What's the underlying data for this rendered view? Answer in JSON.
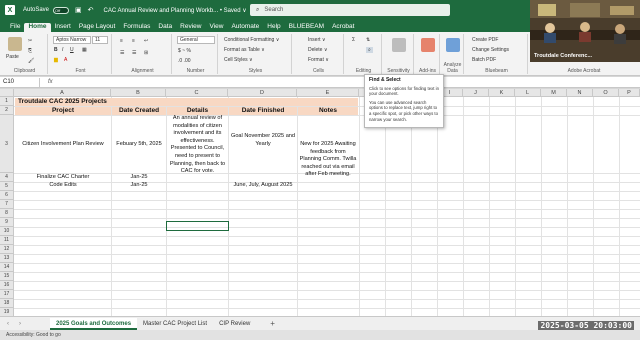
{
  "app": {
    "autosave_label": "AutoSave",
    "autosave_state": "Off",
    "doc_title": "CAC Annual Review and Planning Workb... • Saved ∨",
    "search_placeholder": "Search"
  },
  "menu": [
    "File",
    "Home",
    "Insert",
    "Page Layout",
    "Formulas",
    "Data",
    "Review",
    "View",
    "Automate",
    "Help",
    "BLUEBEAM",
    "Acrobat"
  ],
  "ribbon": {
    "paste": "Paste",
    "clipboard": "Clipboard",
    "font_name": "Aptos Narrow",
    "font_size": "11",
    "font": "Font",
    "alignment": "Alignment",
    "number_format": "General",
    "number": "Number",
    "conditional": "Conditional Formatting ∨",
    "format_table": "Format as Table ∨",
    "cell_styles": "Cell Styles ∨",
    "styles": "Styles",
    "insert": "Insert ∨",
    "delete": "Delete ∨",
    "format": "Format ∨",
    "cells": "Cells",
    "editing": "Editing",
    "sensitivity": "Sensitivity",
    "addins": "Add-ins",
    "analyze": "Analyze Data",
    "create_pdf": "Create PDF",
    "change_settings": "Change Settings",
    "batch_pdf": "Batch PDF",
    "bluebeam": "Bluebeam",
    "adobe": "Adobe Acrobat"
  },
  "formula_bar": {
    "cell_ref": "C10",
    "fx": "fx"
  },
  "tooltip": {
    "title": "Find & Select",
    "line1": "Click to see options for finding text in your document.",
    "line2": "You can use advanced search options to replace text, jump right to a specific spot, or pick other ways to narrow your search."
  },
  "columns": [
    "A",
    "B",
    "C",
    "D",
    "E",
    "F",
    "G",
    "H",
    "I",
    "J",
    "K",
    "L",
    "M",
    "N",
    "O",
    "P"
  ],
  "rows": [
    "1",
    "2",
    "3",
    "4",
    "5",
    "6",
    "7",
    "8",
    "9",
    "10",
    "11",
    "12",
    "13",
    "14",
    "15",
    "16",
    "17",
    "18",
    "19",
    "20",
    "21",
    "22",
    "23",
    "24",
    "25",
    "26"
  ],
  "sheet": {
    "title": "Troutdale CAC 2025 Projects",
    "headers": [
      "Project",
      "Date Created",
      "Details",
      "Date Finished",
      "Notes"
    ],
    "r3": {
      "a": "Citizen Involvement Plan Review",
      "b": "Febuary 5th, 2025",
      "c": "An annual review of modalities of citizen involvement and its effectiveness. Presented to Council, need to present to Planning, then back to CAC for vote.",
      "d": "Goal November 2025 and Yearly",
      "e": "New for 2025 Awaiting feedback from Planning Comm. Twilla reached out via email after Feb meeting."
    },
    "r4": {
      "a": "Finalize CAC Charter",
      "b": "Jan-25"
    },
    "r5": {
      "a": "Code Edits",
      "b": "Jan-25",
      "d": "June, July, August 2025"
    }
  },
  "tabs": [
    "2025 Goals and Outcomes",
    "Master CAC Project List",
    "CIP Review"
  ],
  "status": {
    "accessibility": "Accessibility: Good to go"
  },
  "video": {
    "label": "Troutdale Conferenc..."
  },
  "timestamp": "2025-03-05  20:03:00",
  "colors": {
    "excel_green": "#1e6b3e",
    "header_fill": "#f8d8c3"
  }
}
